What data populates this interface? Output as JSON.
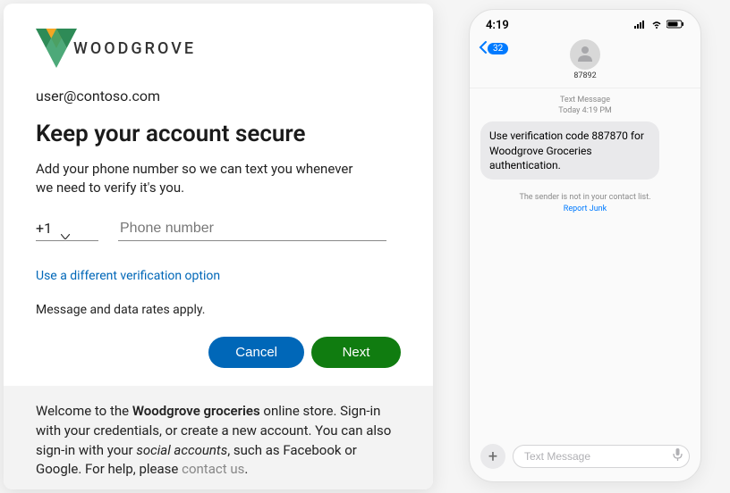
{
  "dialog": {
    "brand_name": "WOODGROVE",
    "user_email": "user@contoso.com",
    "heading": "Keep your account secure",
    "subtext": "Add your phone number so we can text you whenever we need to verify it's you.",
    "country_code": "+1",
    "phone_placeholder": "Phone number",
    "alt_link": "Use a different verification option",
    "rates": "Message and data rates apply.",
    "cancel_label": "Cancel",
    "next_label": "Next",
    "footer_pre": "Welcome to the ",
    "footer_brand": "Woodgrove groceries",
    "footer_mid1": " online store. Sign-in with your credentials, or create a new account. You can also sign-in with your ",
    "footer_social": "social accounts",
    "footer_mid2": ", such as Facebook or Google. For help, please ",
    "footer_contact": "contact us",
    "footer_end": "."
  },
  "phone": {
    "clock": "4:19",
    "back_count": "32",
    "sender": "87892",
    "thread_label": "Text Message",
    "thread_time": "Today 4:19 PM",
    "message": "Use verification code 887870 for Woodgrove Groceries authentication.",
    "junk_text": "The sender is not in your contact list.",
    "report_label": "Report Junk",
    "compose_placeholder": "Text Message"
  }
}
